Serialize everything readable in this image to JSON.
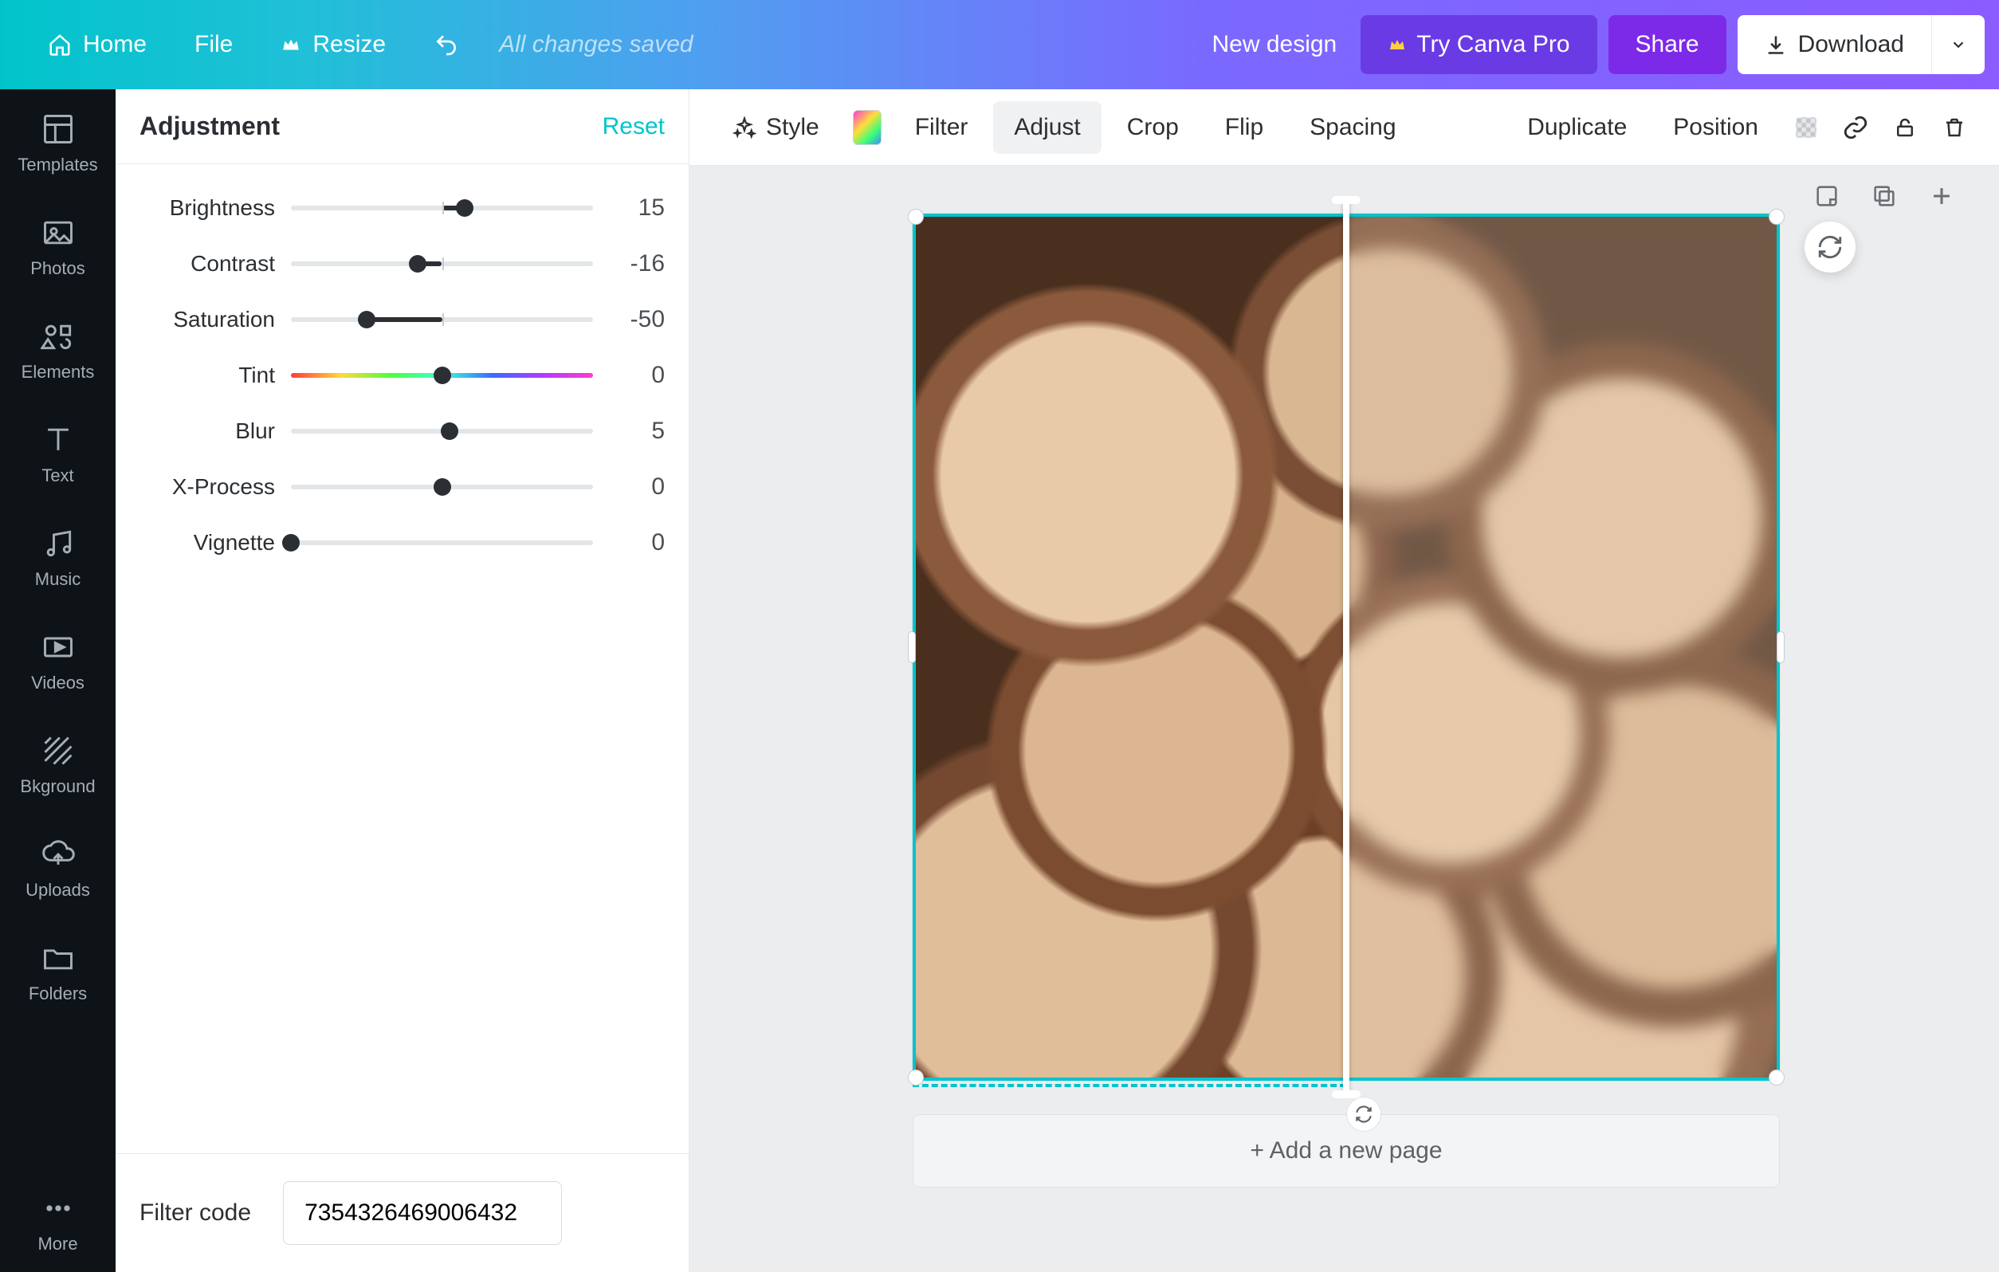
{
  "topbar": {
    "home": "Home",
    "file": "File",
    "resize": "Resize",
    "status": "All changes saved",
    "new_design": "New design",
    "try_pro": "Try Canva Pro",
    "share": "Share",
    "download": "Download"
  },
  "rail": [
    {
      "key": "templates",
      "label": "Templates"
    },
    {
      "key": "photos",
      "label": "Photos"
    },
    {
      "key": "elements",
      "label": "Elements"
    },
    {
      "key": "text",
      "label": "Text"
    },
    {
      "key": "music",
      "label": "Music"
    },
    {
      "key": "videos",
      "label": "Videos"
    },
    {
      "key": "bkground",
      "label": "Bkground"
    },
    {
      "key": "uploads",
      "label": "Uploads"
    },
    {
      "key": "folders",
      "label": "Folders"
    },
    {
      "key": "more",
      "label": "More"
    }
  ],
  "panel": {
    "title": "Adjustment",
    "reset": "Reset",
    "filter_code_label": "Filter code",
    "filter_code_value": "7354326469006432",
    "sliders": [
      {
        "key": "brightness",
        "label": "Brightness",
        "value": 15,
        "min": -100,
        "max": 100,
        "center": true
      },
      {
        "key": "contrast",
        "label": "Contrast",
        "value": -16,
        "min": -100,
        "max": 100,
        "center": true
      },
      {
        "key": "saturation",
        "label": "Saturation",
        "value": -50,
        "min": -100,
        "max": 100,
        "center": true
      },
      {
        "key": "tint",
        "label": "Tint",
        "value": 0,
        "min": -100,
        "max": 100,
        "center": true,
        "tint": true
      },
      {
        "key": "blur",
        "label": "Blur",
        "value": 5,
        "min": -100,
        "max": 100,
        "center": true
      },
      {
        "key": "xprocess",
        "label": "X-Process",
        "value": 0,
        "min": -100,
        "max": 100,
        "center": true
      },
      {
        "key": "vignette",
        "label": "Vignette",
        "value": 0,
        "min": 0,
        "max": 100,
        "center": false
      }
    ]
  },
  "toolbar": {
    "style": "Style",
    "filter": "Filter",
    "adjust": "Adjust",
    "crop": "Crop",
    "flip": "Flip",
    "spacing": "Spacing",
    "duplicate": "Duplicate",
    "position": "Position"
  },
  "canvas": {
    "add_page": "+ Add a new page"
  }
}
